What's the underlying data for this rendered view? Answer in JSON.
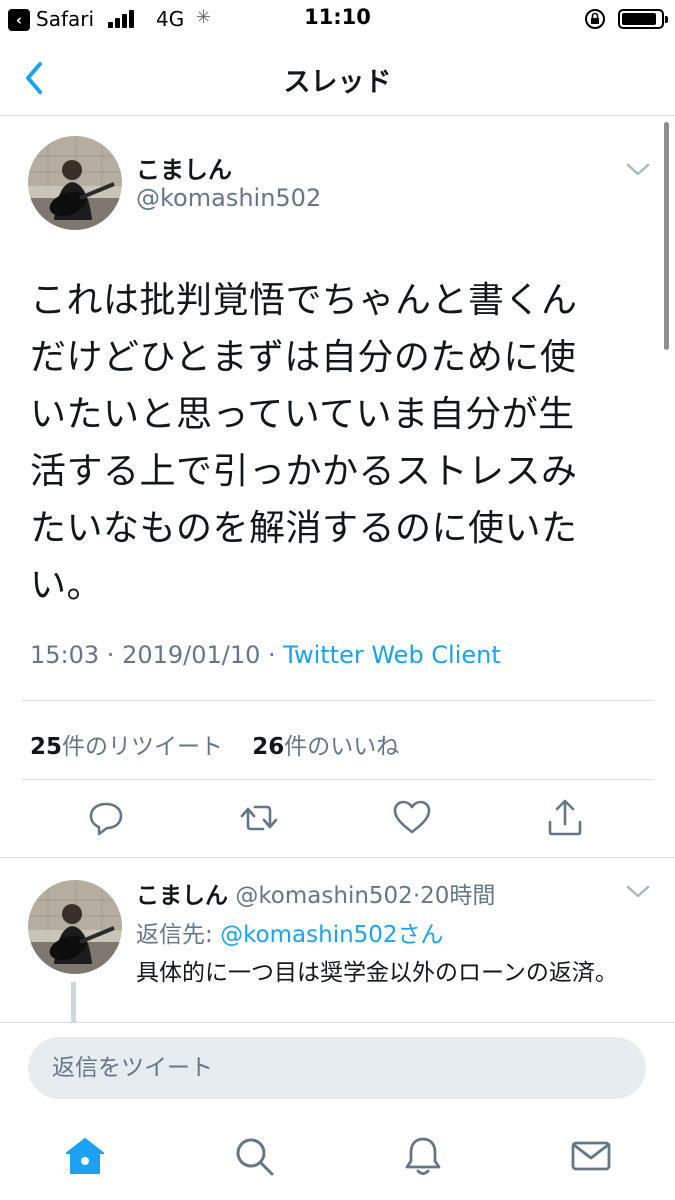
{
  "status_bar": {
    "back_app": "Safari",
    "network": "4G",
    "time": "11:10"
  },
  "header": {
    "title": "スレッド",
    "back_icon": "chevron-left-icon"
  },
  "tweet": {
    "name": "こましん",
    "handle": "@komashin502",
    "text": "これは批判覚悟でちゃんと書くん\nだけどひとまずは自分のために使\nいたいと思っていていま自分が生\n活する上で引っかかるストレスみ\nたいなものを解消するのに使いた\nい。",
    "time": "15:03",
    "date": "2019/01/10",
    "sep": " · ",
    "source": "Twitter Web Client",
    "retweets_count": "25",
    "retweets_label": "件のリツイート",
    "likes_count": "26",
    "likes_label": "件のいいね",
    "actions": [
      "reply-icon",
      "retweet-icon",
      "like-icon",
      "share-icon"
    ]
  },
  "reply": {
    "name": "こましん",
    "handle": "@komashin502",
    "age": "·20時間",
    "reply_to_label": "返信先: ",
    "reply_to_mention": "@komashin502さん",
    "text": "具体的に一つ目は奨学金以外のローンの返済。"
  },
  "compose": {
    "placeholder": "返信をツイート"
  },
  "tabbar": [
    "home-icon",
    "search-icon",
    "notifications-icon",
    "messages-icon"
  ],
  "colors": {
    "accent": "#1da1f2",
    "secondary_text": "#657786",
    "divider": "#d8dde1",
    "compose_bg": "#e6ecf0"
  }
}
